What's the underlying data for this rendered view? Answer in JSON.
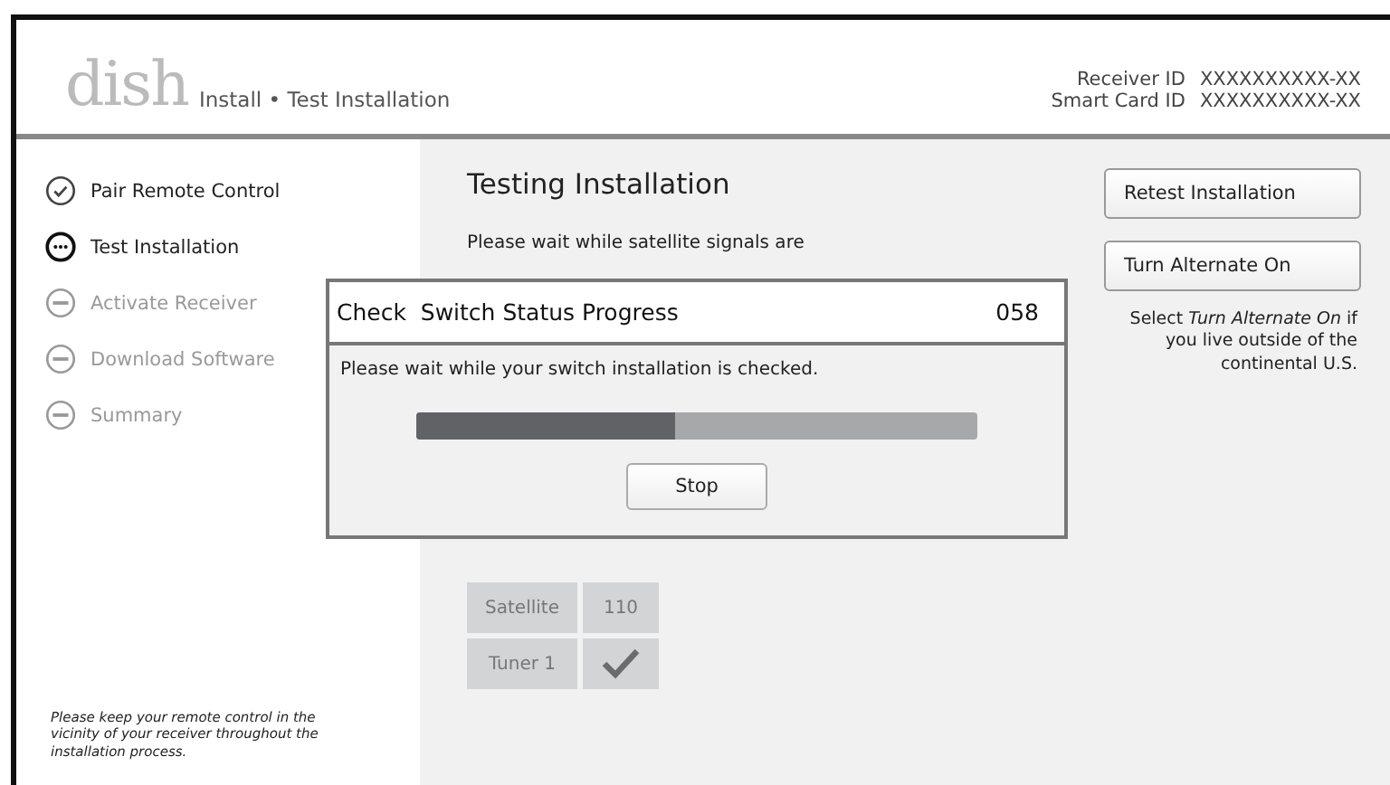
{
  "header": {
    "logo": "dish",
    "breadcrumb": "Install • Test Installation",
    "ids": [
      {
        "label": "Receiver ID",
        "value": "XXXXXXXXXX-XX"
      },
      {
        "label": "Smart Card ID",
        "value": "XXXXXXXXXX-XX"
      }
    ]
  },
  "steps": [
    {
      "label": "Pair Remote Control",
      "kind": "done"
    },
    {
      "label": "Test Installation",
      "kind": "current"
    },
    {
      "label": "Activate Receiver",
      "kind": "pending"
    },
    {
      "label": "Download Software",
      "kind": "pending"
    },
    {
      "label": "Summary",
      "kind": "pending"
    }
  ],
  "sidebar_note": "Please keep your remote control in the vicinity of your receiver throughout the installation process.",
  "main": {
    "title": "Testing Installation",
    "description": "Please wait while satellite signals are"
  },
  "buttons": [
    "Retest Installation",
    "Turn Alternate On"
  ],
  "hint": "Select *Turn Alternate On* if you live outside of the continental U.S.",
  "table": {
    "rows": [
      [
        {
          "kind": "text",
          "text": "Satellite"
        },
        {
          "kind": "text",
          "text": "110"
        }
      ],
      [
        {
          "kind": "text",
          "text": "Tuner 1"
        },
        {
          "kind": "check"
        }
      ]
    ]
  },
  "dialog": {
    "title": "Check  Switch Status Progress",
    "code": "058",
    "message": "Please wait while your switch installation is checked.",
    "level": 0.46,
    "button": "Stop"
  }
}
